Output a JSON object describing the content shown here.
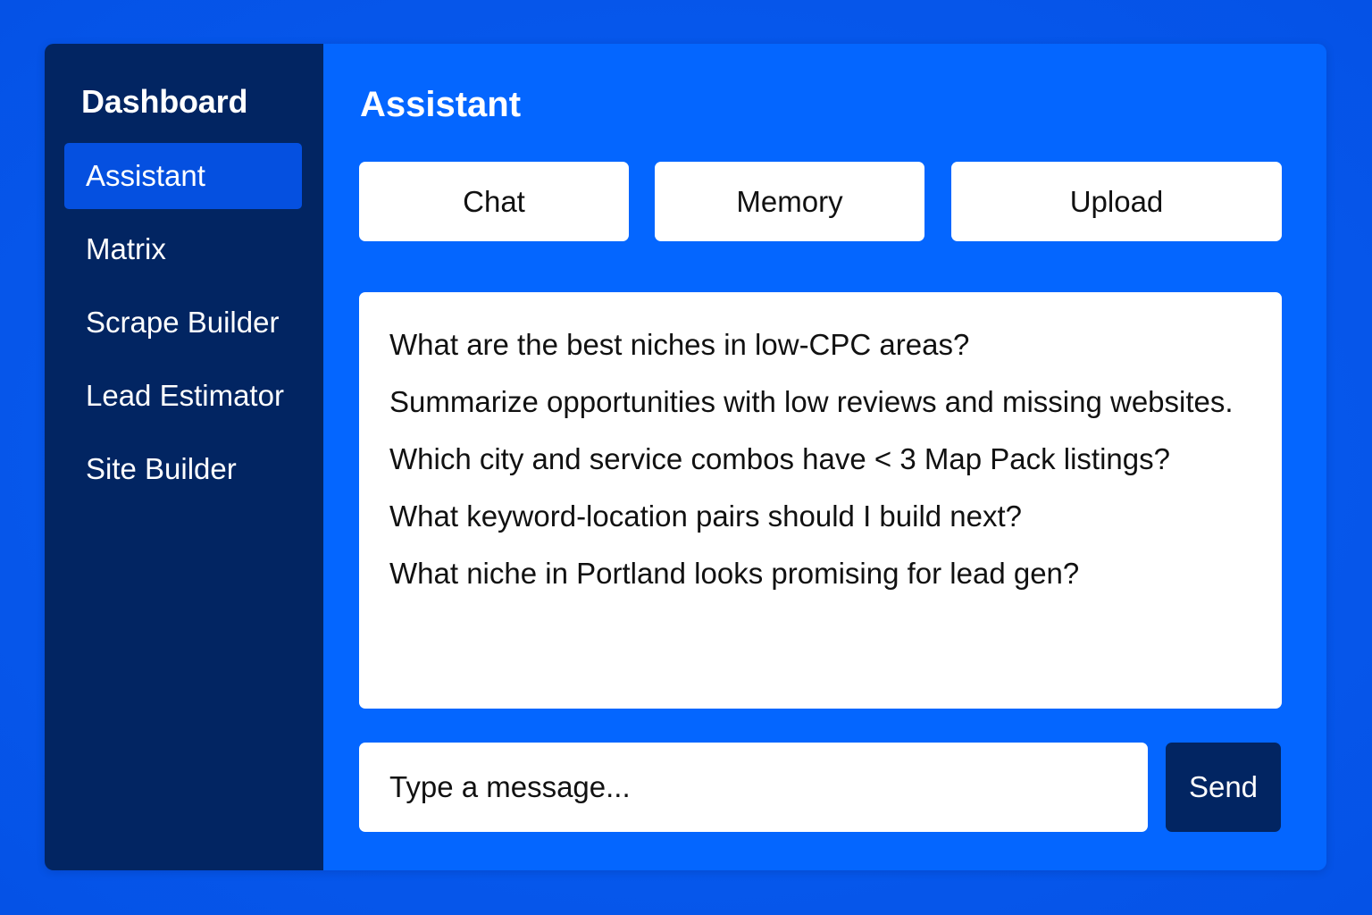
{
  "sidebar": {
    "title": "Dashboard",
    "items": [
      {
        "label": "Assistant",
        "active": true
      },
      {
        "label": "Matrix"
      },
      {
        "label": "Scrape Builder"
      },
      {
        "label": "Lead Estimator"
      },
      {
        "label": "Site Builder"
      }
    ]
  },
  "main": {
    "title": "Assistant",
    "tabs": [
      {
        "label": "Chat"
      },
      {
        "label": "Memory"
      },
      {
        "label": "Upload"
      }
    ],
    "messages": [
      "What are the best niches in low-CPC areas?",
      "Summarize opportunities with low reviews and missing websites.",
      "Which city and service combos have < 3 Map Pack listings?",
      "What keyword-location pairs should I build next?",
      "What niche in Portland looks promising for lead gen?"
    ],
    "input": {
      "placeholder": "Type a message...",
      "value": ""
    },
    "send_label": "Send"
  },
  "colors": {
    "background": "#0658ec",
    "sidebar": "#022562",
    "sidebar_active": "#0550e0",
    "main": "#0466ff",
    "send_button": "#022562"
  }
}
